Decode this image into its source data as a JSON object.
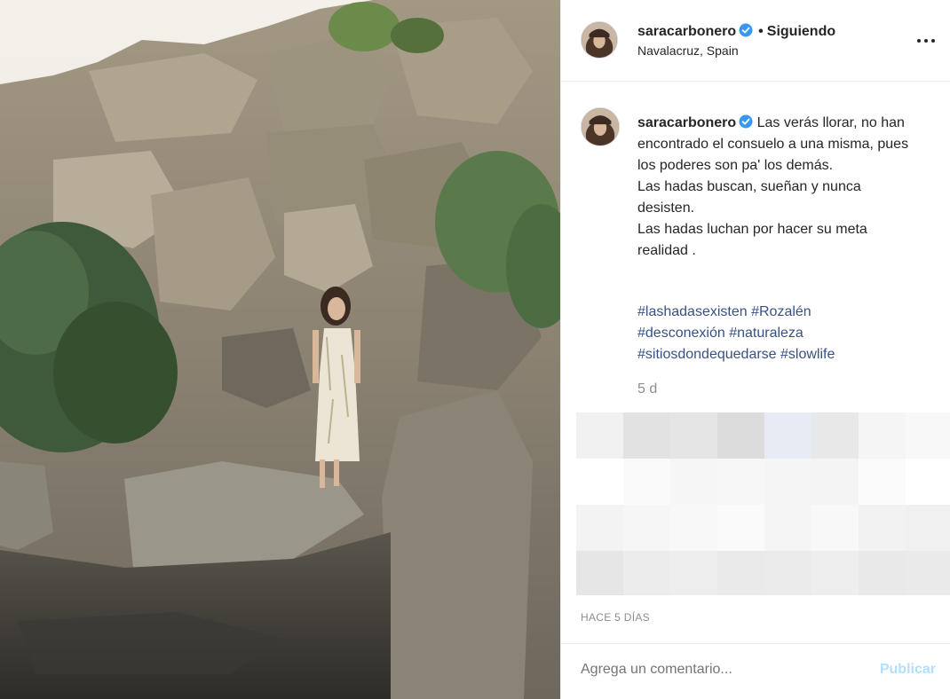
{
  "header": {
    "username": "saracarbonero",
    "separator": "•",
    "follow_status": "Siguiendo",
    "location": "Navalacruz, Spain",
    "more_icon": "more-horizontal-icon"
  },
  "caption": {
    "username": "saracarbonero",
    "lines": [
      "Las verás llorar, no han encontrado el consuelo a una misma, pues los poderes son pa' los demás.",
      "Las hadas buscan, sueñan y nunca desisten.",
      "Las hadas luchan por hacer su meta realidad ."
    ],
    "hashtags": [
      "#lashadasexisten",
      "#Rozalén",
      "#desconexión",
      "#naturaleza",
      "#sitiosdondequedarse",
      "#slowlife"
    ],
    "age": "5 d"
  },
  "timestamp": "HACE 5 DÍAS",
  "comment_box": {
    "placeholder": "Agrega un comentario...",
    "publish_label": "Publicar"
  },
  "colors": {
    "link": "#385185",
    "muted": "#8e8e8e",
    "publish_disabled": "#b2dffc",
    "verified": "#3897f0"
  }
}
